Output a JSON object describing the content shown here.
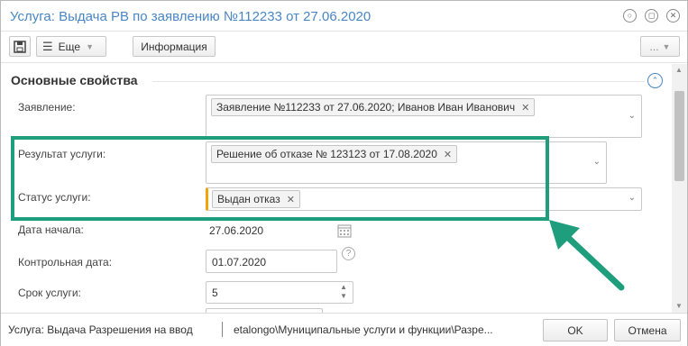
{
  "window": {
    "title": "Услуга: Выдача РВ по заявлению №112233 от 27.06.2020"
  },
  "toolbar": {
    "more_label": "Еще",
    "info_label": "Информация",
    "ellipsis_label": "..."
  },
  "section": {
    "title": "Основные свойства"
  },
  "fields": {
    "application": {
      "label": "Заявление:",
      "tag": "Заявление №112233 от 27.06.2020; Иванов Иван Иванович"
    },
    "result": {
      "label": "Результат услуги:",
      "tag": "Решение об отказе № 123123 от 17.08.2020"
    },
    "status": {
      "label": "Статус услуги:",
      "tag": "Выдан отказ",
      "accent_color": "#f0a30a"
    },
    "start_date": {
      "label": "Дата начала:",
      "value": "27.06.2020"
    },
    "control_date": {
      "label": "Контрольная дата:",
      "value": "01.07.2020"
    },
    "term": {
      "label": "Срок услуги:",
      "value": "5"
    }
  },
  "status_bar": {
    "service_text": "Услуга: Выдача Разрешения на ввод",
    "path_text": "etalongo\\Муниципальные услуги и функции\\Разре...",
    "ok_label": "OK",
    "cancel_label": "Отмена"
  },
  "colors": {
    "title": "#4a86c5",
    "highlight": "#1e9e7c",
    "arrow": "#1e9e7c"
  }
}
